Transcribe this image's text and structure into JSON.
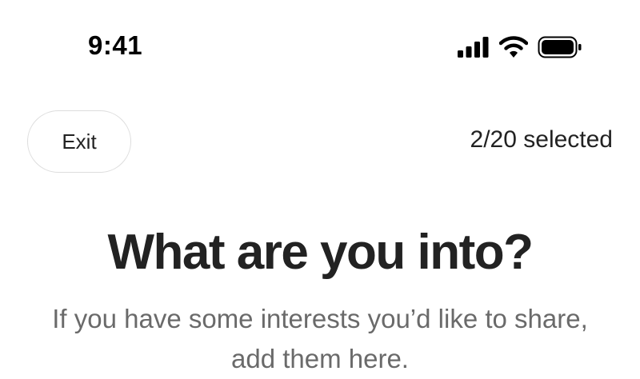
{
  "status_bar": {
    "time": "9:41",
    "icons": [
      "cellular-signal-icon",
      "wifi-icon",
      "battery-icon"
    ]
  },
  "header": {
    "exit_label": "Exit",
    "selection_count": "2/20 selected"
  },
  "main": {
    "title": "What are you into?",
    "subtitle": "If you have some interests you’d like to share, add them here."
  },
  "colors": {
    "text_primary": "#222222",
    "text_secondary": "#6a6a6a",
    "button_border": "#dddddd",
    "background": "#ffffff"
  }
}
